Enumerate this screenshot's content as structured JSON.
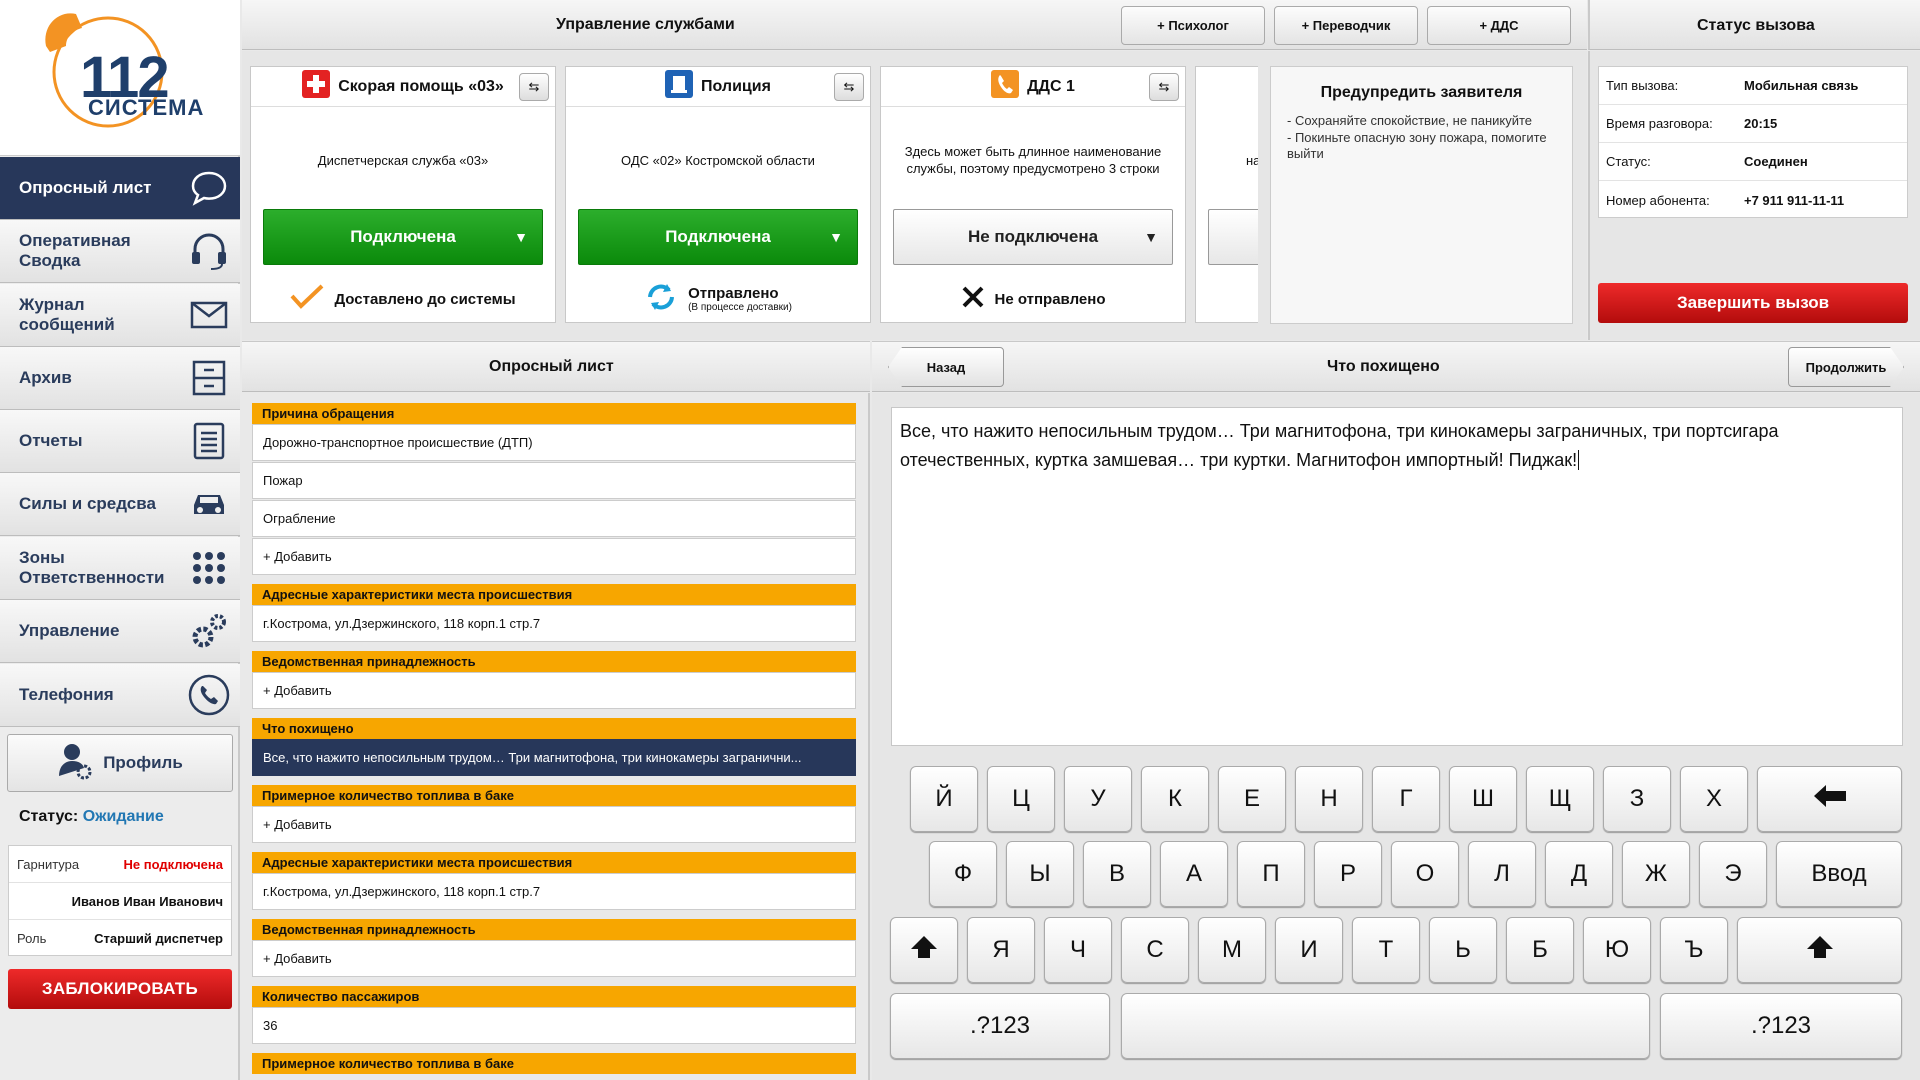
{
  "logo": {
    "number": "112",
    "text": "СИСТЕМА"
  },
  "nav": [
    {
      "label": "Опросный лист",
      "icon": "chat-bubble-icon"
    },
    {
      "label": "Оперативная\nСводка",
      "icon": "headset-icon"
    },
    {
      "label": "Журнал\nсообщений",
      "icon": "envelope-icon"
    },
    {
      "label": "Архив",
      "icon": "archive-icon"
    },
    {
      "label": "Отчеты",
      "icon": "document-icon"
    },
    {
      "label": "Силы и средсва",
      "icon": "car-icon"
    },
    {
      "label": "Зоны\nОтветственности",
      "icon": "grid-dots-icon"
    },
    {
      "label": "Управление",
      "icon": "gears-icon"
    },
    {
      "label": "Телефония",
      "icon": "phone-icon"
    }
  ],
  "profile": {
    "label": "Профиль",
    "status_label": "Статус:",
    "status_value": "Ожидание"
  },
  "user": {
    "headset_label": "Гарнитура",
    "headset_value": "Не подключена",
    "name": "Иванов Иван Иванович",
    "role_label": "Роль",
    "role_value": "Старший диспетчер"
  },
  "block_button": "ЗАБЛОКИРОВАТЬ",
  "services": {
    "title": "Управление службами",
    "buttons": [
      "+ Психолог",
      "+ Переводчик",
      "+ ДДС"
    ],
    "cards": [
      {
        "name": "Скорая помощь «03»",
        "desc": "Диспетчерская служба «03»",
        "status": "Подключена",
        "delivery": "Доставлено до системы",
        "delivery_note": ""
      },
      {
        "name": "Полиция",
        "desc": "ОДС «02» Костромской области",
        "status": "Подключена",
        "delivery": "Отправлено",
        "delivery_note": "(В процессе доставки)"
      },
      {
        "name": "ДДС 1",
        "desc": "Здесь может быть длинное наименование службы, поэтому предусмотрено 3 строки",
        "status": "Не подключена",
        "delivery": "Не отправлено",
        "delivery_note": ""
      }
    ],
    "partial_card_desc": "на"
  },
  "warning": {
    "title": "Предупредить заявителя",
    "items": [
      "- Сохраняйте спокойствие, не паникуйте",
      "- Покиньте опасную зону пожара, помогите выйти"
    ]
  },
  "call_status": {
    "title": "Статус вызова",
    "rows": [
      {
        "k": "Тип вызова:",
        "v": "Мобильная связь"
      },
      {
        "k": "Время разговора:",
        "v": "20:15"
      },
      {
        "k": "Статус:",
        "v": "Соединен"
      },
      {
        "k": "Номер абонента:",
        "v": "+7 911 911-11-11"
      }
    ],
    "end_button": "Завершить вызов"
  },
  "questionnaire": {
    "title": "Опросный лист",
    "sec1": "Причина обращения",
    "r1": "Дорожно-транспортное происшествие (ДТП)",
    "r2": "Пожар",
    "r3": "Ограбление",
    "add": "+ Добавить",
    "sec2": "Адресные характеристики места происшествия",
    "addr": "г.Кострома, ул.Дзержинского, 118 корп.1 стр.7",
    "sec3": "Ведомственная принадлежность",
    "sec4": "Что похищено",
    "stolen": "Все, что нажито непосильным трудом… Три магнитофона, три кинокамеры загранични...",
    "sec5": "Примерное количество топлива в баке",
    "sec6": "Количество пассажиров",
    "passengers": "36"
  },
  "editor": {
    "back": "Назад",
    "title": "Что похищено",
    "next": "Продолжить",
    "text": "Все, что нажито непосильным трудом… Три магнитофона, три кинокамеры заграничных, три портсигара отечественных, куртка замшевая… три куртки. Магнитофон импортный! Пиджак!"
  },
  "keyboard": {
    "row1": [
      "Й",
      "Ц",
      "У",
      "К",
      "Е",
      "Н",
      "Г",
      "Ш",
      "Щ",
      "З",
      "Х"
    ],
    "row2": [
      "Ф",
      "Ы",
      "В",
      "А",
      "П",
      "Р",
      "О",
      "Л",
      "Д",
      "Ж",
      "Э"
    ],
    "enter": "Ввод",
    "row3": [
      "Я",
      "Ч",
      "С",
      "М",
      "И",
      "Т",
      "Ь",
      "Б",
      "Ю",
      "Ъ"
    ],
    "numeric": ".?123"
  }
}
